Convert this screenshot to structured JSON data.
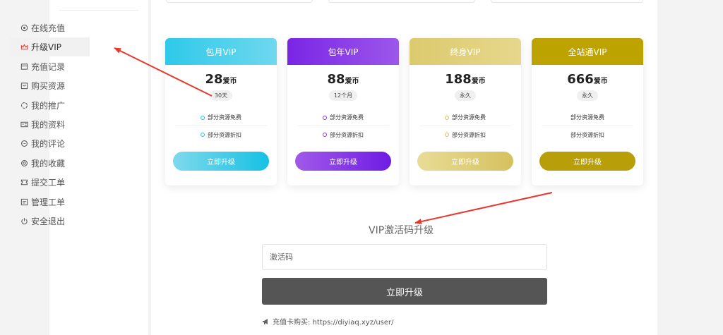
{
  "sidebar": {
    "items": [
      {
        "label": "在线充值",
        "icon": "coin-icon"
      },
      {
        "label": "升级VIP",
        "icon": "crown-icon",
        "active": true
      },
      {
        "label": "充值记录",
        "icon": "record-icon"
      },
      {
        "label": "购买资源",
        "icon": "bag-icon"
      },
      {
        "label": "我的推广",
        "icon": "share-icon"
      },
      {
        "label": "我的资料",
        "icon": "id-card-icon"
      },
      {
        "label": "我的评论",
        "icon": "comment-icon"
      },
      {
        "label": "我的收藏",
        "icon": "star-icon"
      },
      {
        "label": "提交工单",
        "icon": "ticket-icon"
      },
      {
        "label": "管理工单",
        "icon": "edit-icon"
      },
      {
        "label": "安全退出",
        "icon": "power-icon"
      }
    ]
  },
  "plans": [
    {
      "name": "包月VIP",
      "price": "28",
      "unit": "爱币",
      "duration": "30天",
      "features": [
        "部分资源免费",
        "部分资源折扣"
      ],
      "button": "立即升级",
      "color": "#17c2e3",
      "head_from": "#2fc9ea",
      "head_to": "#6fd8ee",
      "btn_from": "#7fd9ec",
      "btn_to": "#16c1e4"
    },
    {
      "name": "包年VIP",
      "price": "88",
      "unit": "爱币",
      "duration": "12个月",
      "features": [
        "部分资源免费",
        "部分资源折扣"
      ],
      "button": "立即升级",
      "color": "#8a36e6",
      "head_from": "#7a25e6",
      "head_to": "#9c57ea",
      "btn_from": "#a05ae9",
      "btn_to": "#6f1ce4"
    },
    {
      "name": "终身VIP",
      "price": "188",
      "unit": "爱币",
      "duration": "永久",
      "features": [
        "部分资源免费",
        "部分资源折扣"
      ],
      "button": "立即升级",
      "color": "#d5bf5c",
      "head_from": "#dcca6e",
      "head_to": "#e6d78c",
      "btn_from": "#e8dc96",
      "btn_to": "#d6c15f"
    },
    {
      "name": "全站通VIP",
      "price": "666",
      "unit": "爱币",
      "duration": "永久",
      "features": [
        "部分资源免费",
        "部分资源折扣"
      ],
      "button": "立即升级",
      "color": "#b8a00b",
      "head_from": "#bca300",
      "head_to": "#bca300",
      "btn_from": "#b89f0a",
      "btn_to": "#b89f0a"
    }
  ],
  "activation": {
    "title": "VIP激活码升级",
    "placeholder": "激活码",
    "button": "立即升级",
    "note": "充值卡购买: https://diyiaq.xyz/user/"
  }
}
